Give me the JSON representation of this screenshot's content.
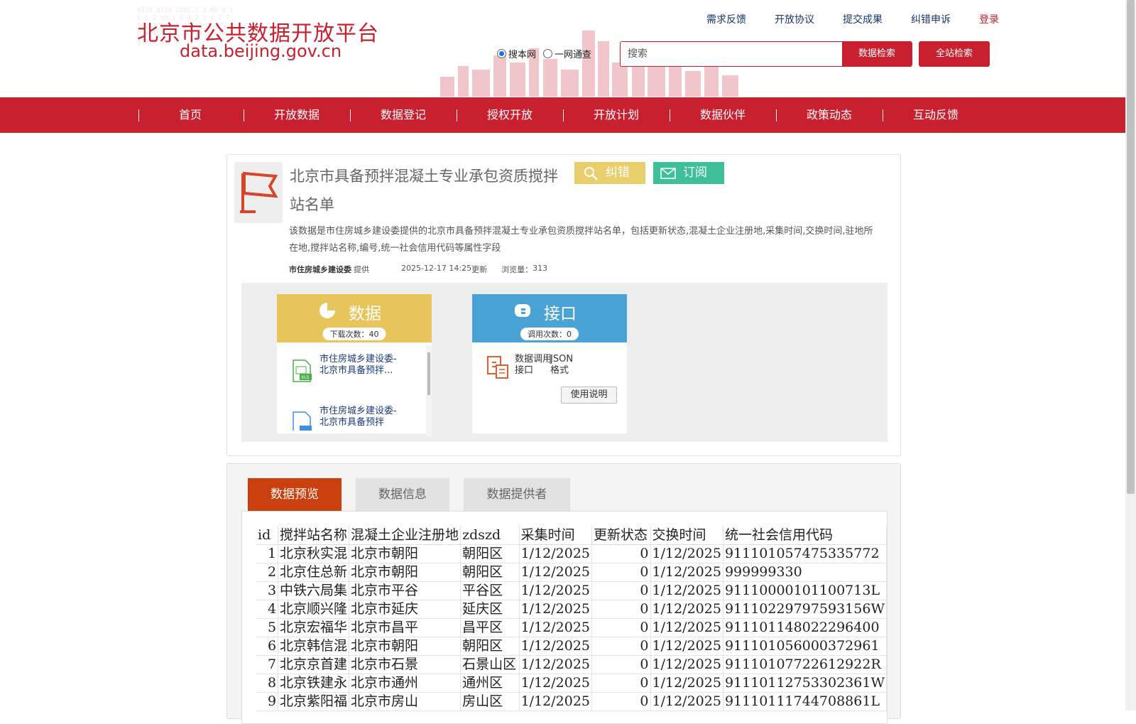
{
  "header": {
    "logo_cn": "北京市公共数据开放平台",
    "logo_en": "data.beijing.gov.cn",
    "top_links": [
      "需求反馈",
      "开放协议",
      "提交成果",
      "纠错申诉"
    ],
    "login": "登录",
    "radio_options": [
      "搜本网",
      "一网通查"
    ],
    "search_placeholder": "搜索",
    "search_button": "数据检索",
    "global_search_button": "全站检索"
  },
  "nav": {
    "items": [
      "首页",
      "开放数据",
      "数据登记",
      "授权开放",
      "开放计划",
      "数据伙伴",
      "政策动态",
      "互动反馈"
    ]
  },
  "dataset": {
    "title": "北京市具备预拌混凝土专业承包资质搅拌站名单",
    "error_button": "纠错",
    "subscribe_button": "订阅",
    "description": "该数据是市住房城乡建设委提供的北京市具备预拌混凝土专业承包资质搅拌站名单，包括更新状态,混凝土企业注册地,采集时间,交换时间,驻地所在地,搅拌站名称,编号,统一社会信用代码等属性字段",
    "provider": "市住房城乡建设委",
    "provider_suffix": "提供",
    "updated": "2025-12-17 14:25",
    "updated_suffix": "更新",
    "views_label": "浏览量：",
    "views": "313"
  },
  "download_card": {
    "title": "数据",
    "count_label": "下载次数：40",
    "files": [
      {
        "name": "市住房城乡建设委-北京市具备预拌...",
        "type": "XLS"
      },
      {
        "name": "市住房城乡建设委-北京市具备预拌",
        "type": "PDF"
      }
    ]
  },
  "api_card": {
    "title": "接口",
    "count_label": "调用次数：0",
    "api_name": "数据调用接口",
    "format": "JSON格式",
    "usage_button": "使用说明"
  },
  "tabs": [
    "数据预览",
    "数据信息",
    "数据提供者"
  ],
  "sheet": {
    "headers": [
      "id",
      "搅拌站名称",
      "混凝土企业注册地",
      "zdszd",
      "采集时间",
      "更新状态",
      "交换时间",
      "统一社会信用代码"
    ],
    "rows": [
      [
        "1",
        "北京秋实混",
        "北京市朝阳",
        "朝阳区",
        "1/12/2025",
        "0",
        "1/12/2025",
        "91110105747533577​2"
      ],
      [
        "2",
        "北京住总新",
        "北京市朝阳",
        "朝阳区",
        "1/12/2025",
        "0",
        "1/12/2025",
        " 999999330"
      ],
      [
        "3",
        "中铁六局集",
        "北京市平谷",
        "平谷区",
        "1/12/2025",
        "0",
        "1/12/2025",
        "91110000101100713L"
      ],
      [
        "4",
        "北京顺兴隆",
        "北京市延庆",
        "延庆区",
        "1/12/2025",
        "0",
        "1/12/2025",
        "91110229797593156W"
      ],
      [
        "5",
        "北京宏福华",
        "北京市昌平",
        "昌平区",
        "1/12/2025",
        "0",
        "1/12/2025",
        "911101148022296400"
      ],
      [
        "6",
        "北京韩信混",
        "北京市朝阳",
        "朝阳区",
        "1/12/2025",
        "0",
        "1/12/2025",
        "911101056000372961"
      ],
      [
        "7",
        "北京京首建",
        "北京市石景",
        "石景山区",
        "1/12/2025",
        "0",
        "1/12/2025",
        "91110107722612922R"
      ],
      [
        "8",
        "北京铁建永",
        "北京市通州",
        "通州区",
        "1/12/2025",
        "0",
        "1/12/2025",
        "91110112753302361W"
      ],
      [
        "9",
        "北京紫阳福",
        "北京市房山",
        "房山区",
        "1/12/2025",
        "0",
        "1/12/2025",
        "91110111744708861L"
      ]
    ]
  },
  "colors": {
    "brand_red": "#c8202f",
    "active_tab": "#c93f0e",
    "error_yellow": "#e9cf6b",
    "subscribe_green": "#3ebf9a",
    "api_blue": "#4aa3d5"
  }
}
